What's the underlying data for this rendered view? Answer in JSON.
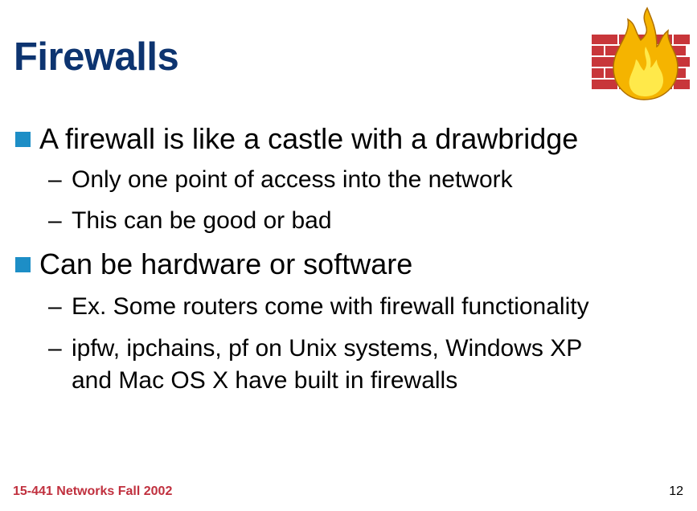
{
  "slide": {
    "title": "Firewalls",
    "logo_icon": "firewall-brick-wall-flame-icon",
    "bullets": [
      {
        "text": "A firewall is like a castle with a drawbridge",
        "sub": [
          {
            "dash": "–",
            "text": "Only one point of access into the network"
          },
          {
            "dash": "–",
            "text": "This can be good or bad"
          }
        ]
      },
      {
        "text": "Can be hardware or software",
        "sub": [
          {
            "dash": "–",
            "text": "Ex. Some routers come with firewall functionality"
          },
          {
            "dash": "–",
            "text": "ipfw, ipchains, pf on Unix systems, Windows XP",
            "text_cont": "and Mac OS X have built in firewalls"
          }
        ]
      }
    ]
  },
  "footer": {
    "course": "15-441 Networks Fall 2002",
    "page_number": "12"
  },
  "colors": {
    "title": "#0d3470",
    "bullet_marker": "#1d8ec6",
    "footer_course": "#c0303e",
    "brick": "#c8363a",
    "flame_outer": "#f5b400",
    "flame_inner": "#ffe94a"
  }
}
